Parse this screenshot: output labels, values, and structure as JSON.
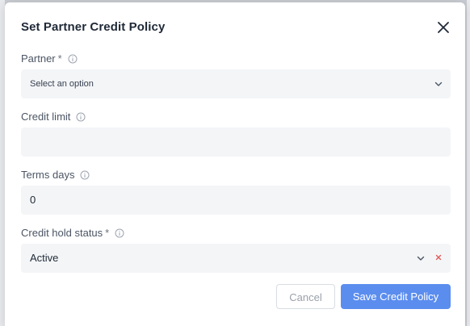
{
  "modal": {
    "title": "Set Partner Credit Policy"
  },
  "fields": {
    "partner": {
      "label": "Partner",
      "required_mark": "*",
      "placeholder": "Select an option"
    },
    "credit_limit": {
      "label": "Credit limit",
      "value": ""
    },
    "terms_days": {
      "label": "Terms days",
      "value": "0"
    },
    "credit_hold_status": {
      "label": "Credit hold status",
      "required_mark": "*",
      "value": "Active"
    }
  },
  "buttons": {
    "cancel": "Cancel",
    "save": "Save Credit Policy"
  },
  "icons": {
    "close": "close-icon",
    "info": "info-icon",
    "chevron": "chevron-down-icon",
    "clear": "clear-icon"
  },
  "colors": {
    "primary": "#5b8def",
    "clear_icon": "#e05a5a",
    "field_bg": "#f4f5f7"
  }
}
